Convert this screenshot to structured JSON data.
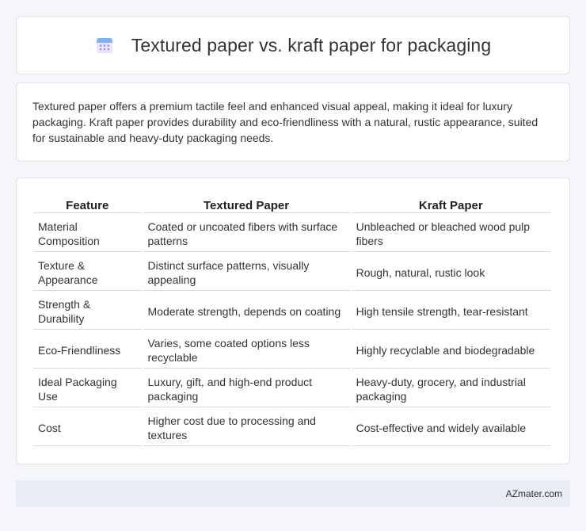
{
  "header": {
    "title": "Textured paper vs. kraft paper for packaging",
    "icon": "calendar-icon"
  },
  "intro": {
    "text": "Textured paper offers a premium tactile feel and enhanced visual appeal, making it ideal for luxury packaging. Kraft paper provides durability and eco-friendliness with a natural, rustic appearance, suited for sustainable and heavy-duty packaging needs."
  },
  "table": {
    "headers": [
      "Feature",
      "Textured Paper",
      "Kraft Paper"
    ],
    "rows": [
      [
        "Material Composition",
        "Coated or uncoated fibers with surface patterns",
        "Unbleached or bleached wood pulp fibers"
      ],
      [
        "Texture & Appearance",
        "Distinct surface patterns, visually appealing",
        "Rough, natural, rustic look"
      ],
      [
        "Strength & Durability",
        "Moderate strength, depends on coating",
        "High tensile strength, tear-resistant"
      ],
      [
        "Eco-Friendliness",
        "Varies, some coated options less recyclable",
        "Highly recyclable and biodegradable"
      ],
      [
        "Ideal Packaging Use",
        "Luxury, gift, and high-end product packaging",
        "Heavy-duty, grocery, and industrial packaging"
      ],
      [
        "Cost",
        "Higher cost due to processing and textures",
        "Cost-effective and widely available"
      ]
    ]
  },
  "footer": {
    "site": "AZmater.com"
  }
}
